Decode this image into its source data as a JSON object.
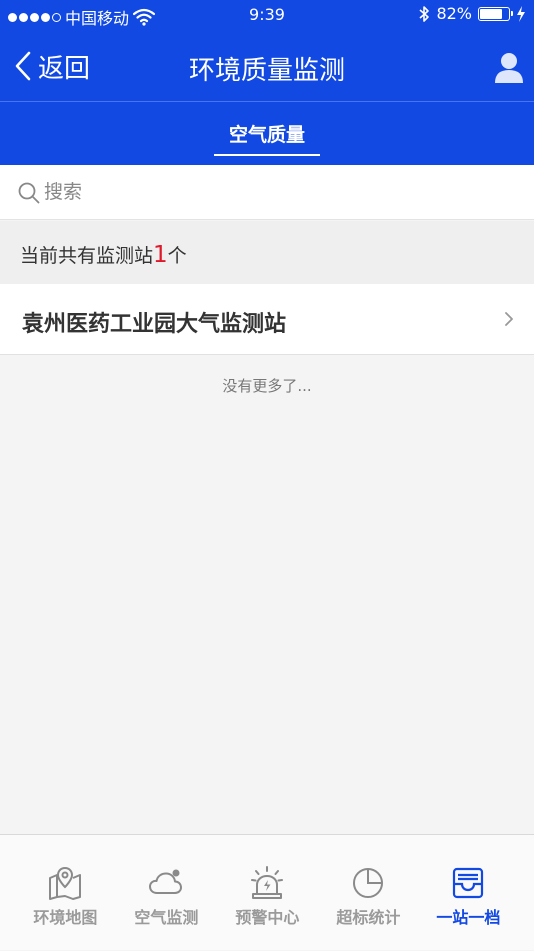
{
  "status_bar": {
    "carrier": "中国移动",
    "time": "9:39",
    "battery_percent": "82%",
    "battery_level": 0.82,
    "signal_bars_filled": 4,
    "signal_bars_total": 5
  },
  "nav": {
    "back_label": "返回",
    "title": "环境质量监测"
  },
  "tabs": [
    {
      "label": "空气质量",
      "active": true
    }
  ],
  "search": {
    "placeholder": "搜索",
    "value": ""
  },
  "summary": {
    "prefix": "当前共有监测站",
    "count": "1",
    "suffix": "个"
  },
  "stations": [
    {
      "name": "袁州医药工业园大气监测站"
    }
  ],
  "list_footer": "没有更多了...",
  "bottom_nav": [
    {
      "label": "环境地图",
      "icon": "map-icon",
      "active": false
    },
    {
      "label": "空气监测",
      "icon": "cloud-icon",
      "active": false
    },
    {
      "label": "预警中心",
      "icon": "alarm-light-icon",
      "active": false
    },
    {
      "label": "超标统计",
      "icon": "pie-chart-icon",
      "active": false
    },
    {
      "label": "一站一档",
      "icon": "inbox-icon",
      "active": true
    }
  ],
  "colors": {
    "primary": "#1249e3",
    "accent_red": "#e0182a",
    "inactive_gray": "#9a9a9a",
    "background": "#f4f4f4"
  }
}
